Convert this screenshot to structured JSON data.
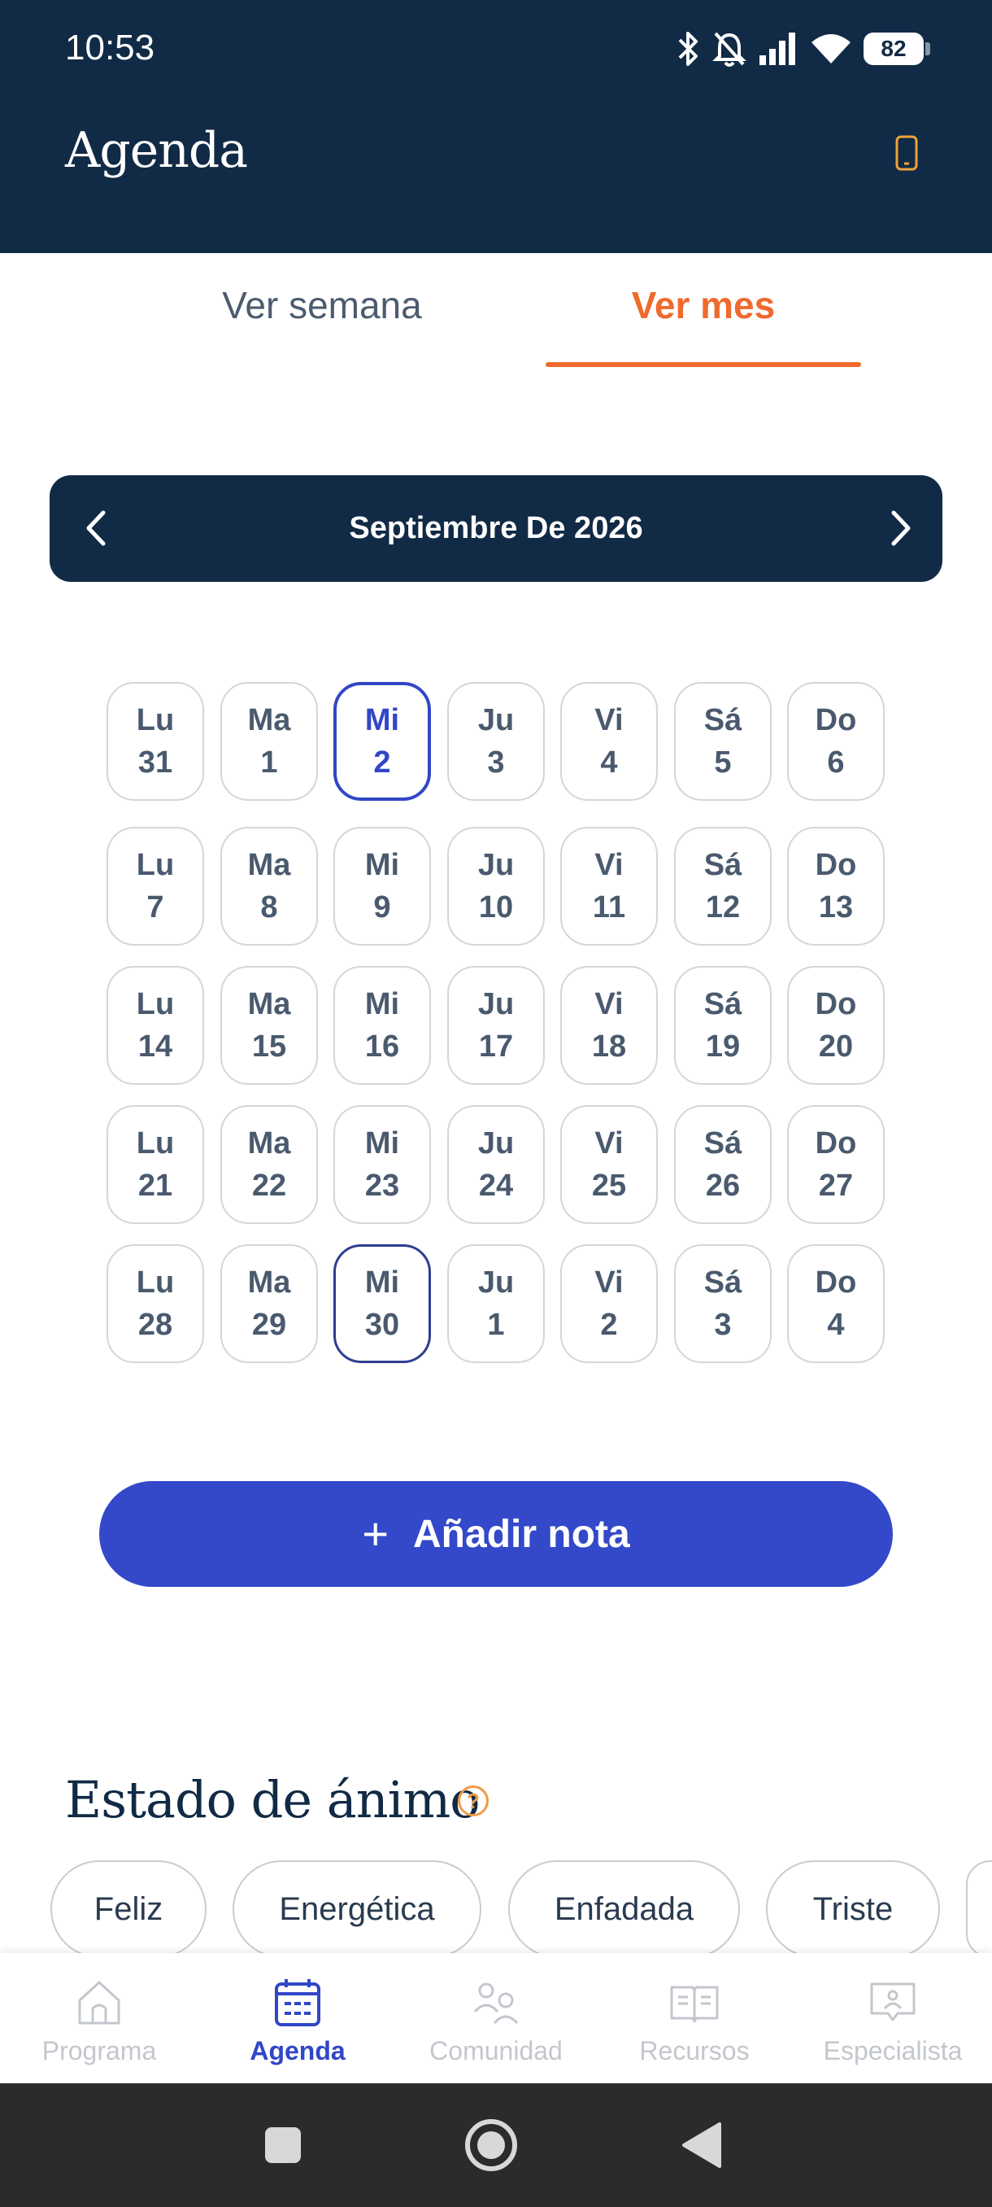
{
  "status_bar": {
    "time": "10:53",
    "battery": "82"
  },
  "header": {
    "title": "Agenda"
  },
  "tabs": [
    {
      "label": "Ver semana",
      "active": false
    },
    {
      "label": "Ver mes",
      "active": true
    }
  ],
  "month_nav": {
    "label": "Septiembre De 2026"
  },
  "calendar": {
    "rows": [
      [
        {
          "d": "Lu",
          "n": "31"
        },
        {
          "d": "Ma",
          "n": "1"
        },
        {
          "d": "Mi",
          "n": "2",
          "state": "selected"
        },
        {
          "d": "Ju",
          "n": "3"
        },
        {
          "d": "Vi",
          "n": "4"
        },
        {
          "d": "Sá",
          "n": "5"
        },
        {
          "d": "Do",
          "n": "6"
        }
      ],
      [
        {
          "d": "Lu",
          "n": "7"
        },
        {
          "d": "Ma",
          "n": "8"
        },
        {
          "d": "Mi",
          "n": "9"
        },
        {
          "d": "Ju",
          "n": "10"
        },
        {
          "d": "Vi",
          "n": "11"
        },
        {
          "d": "Sá",
          "n": "12"
        },
        {
          "d": "Do",
          "n": "13"
        }
      ],
      [
        {
          "d": "Lu",
          "n": "14"
        },
        {
          "d": "Ma",
          "n": "15"
        },
        {
          "d": "Mi",
          "n": "16"
        },
        {
          "d": "Ju",
          "n": "17"
        },
        {
          "d": "Vi",
          "n": "18"
        },
        {
          "d": "Sá",
          "n": "19"
        },
        {
          "d": "Do",
          "n": "20"
        }
      ],
      [
        {
          "d": "Lu",
          "n": "21"
        },
        {
          "d": "Ma",
          "n": "22"
        },
        {
          "d": "Mi",
          "n": "23"
        },
        {
          "d": "Ju",
          "n": "24"
        },
        {
          "d": "Vi",
          "n": "25"
        },
        {
          "d": "Sá",
          "n": "26"
        },
        {
          "d": "Do",
          "n": "27"
        }
      ],
      [
        {
          "d": "Lu",
          "n": "28"
        },
        {
          "d": "Ma",
          "n": "29"
        },
        {
          "d": "Mi",
          "n": "30",
          "state": "outlined"
        },
        {
          "d": "Ju",
          "n": "1"
        },
        {
          "d": "Vi",
          "n": "2"
        },
        {
          "d": "Sá",
          "n": "3"
        },
        {
          "d": "Do",
          "n": "4"
        }
      ]
    ]
  },
  "add_note": {
    "label": "Añadir nota"
  },
  "mood": {
    "title": "Estado de ánimo",
    "help": "?",
    "chips": [
      "Feliz",
      "Energética",
      "Enfadada",
      "Triste"
    ]
  },
  "bottom_nav": [
    {
      "label": "Programa",
      "icon": "home-icon",
      "active": false
    },
    {
      "label": "Agenda",
      "icon": "calendar-icon",
      "active": true
    },
    {
      "label": "Comunidad",
      "icon": "community-icon",
      "active": false
    },
    {
      "label": "Recursos",
      "icon": "book-icon",
      "active": false
    },
    {
      "label": "Especialista",
      "icon": "specialist-icon",
      "active": false
    }
  ],
  "colors": {
    "header_bg": "#112a45",
    "accent_orange": "#ef6a2c",
    "accent_blue": "#3349c9"
  }
}
